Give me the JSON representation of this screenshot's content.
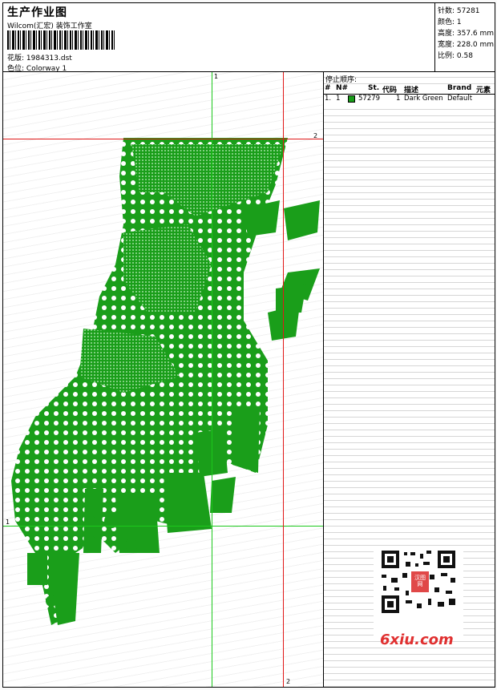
{
  "header": {
    "title": "生产作业图",
    "studio": "Wilcom(汇宏) 装饰工作室",
    "design_label": "花版:",
    "design_file": "1984313.dst",
    "colorway_label": "色位:",
    "colorway": "Colorway 1"
  },
  "stats": {
    "stitches": "针数: 57281",
    "colors": "颜色: 1",
    "height": "高度: 357.6 mm",
    "width": "宽度: 228.0 mm",
    "scale": "比例: 0.58"
  },
  "sequence": {
    "title": "停止顺序:",
    "columns": [
      "#",
      "N#",
      "St.",
      "代码",
      "描述",
      "Brand",
      "元素"
    ],
    "rows": [
      {
        "index": "1.",
        "needle": "1",
        "stitches": "57279",
        "code": "1",
        "description": "Dark Green",
        "brand": "Default",
        "color": "#1a9e1a"
      }
    ]
  },
  "guides": {
    "v1": "1",
    "h1": "1",
    "h2": "2",
    "v2": "2"
  },
  "watermark": {
    "logo": "6xiu.com",
    "seal": "汉图网"
  },
  "colors": {
    "stitch": "#1a9e1a",
    "guide_green": "#1cc81c",
    "guide_red": "#e01818"
  }
}
